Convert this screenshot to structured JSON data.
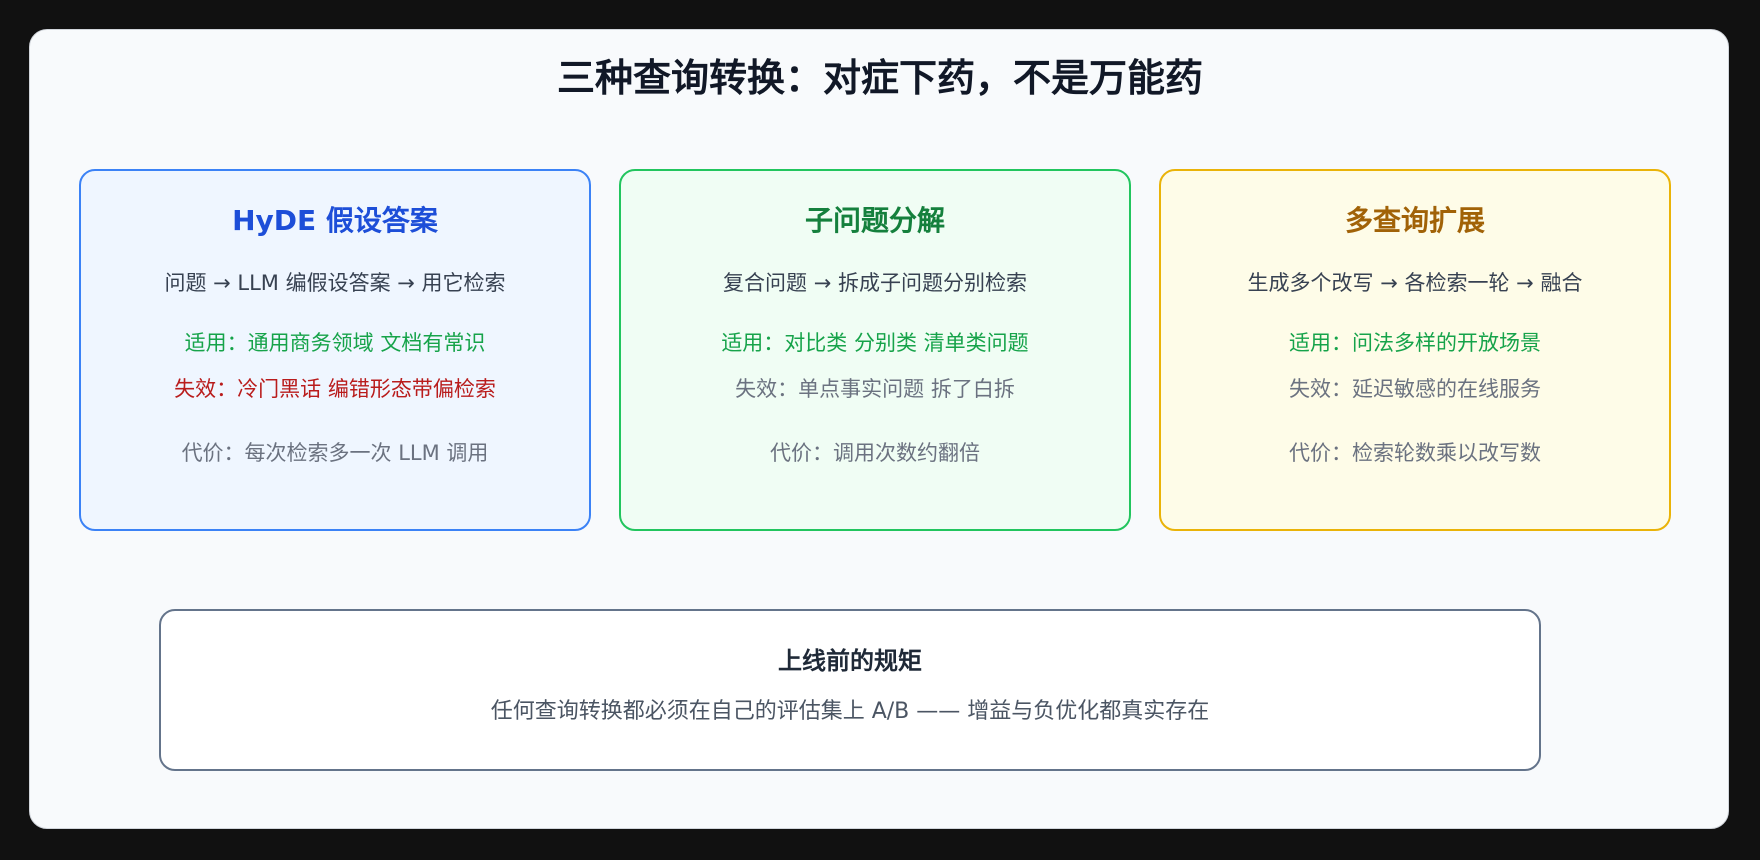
{
  "title": "三种查询转换：对症下药，不是万能药",
  "cards": [
    {
      "title": "HyDE 假设答案",
      "flow": "问题 → LLM 编假设答案 → 用它检索",
      "apply": "适用：通用商务领域 文档有常识",
      "fail": "失效：冷门黑话 编错形态带偏检索",
      "cost": "代价：每次检索多一次 LLM 调用"
    },
    {
      "title": "子问题分解",
      "flow": "复合问题 → 拆成子问题分别检索",
      "apply": "适用：对比类 分别类 清单类问题",
      "fail": "失效：单点事实问题 拆了白拆",
      "cost": "代价：调用次数约翻倍"
    },
    {
      "title": "多查询扩展",
      "flow": "生成多个改写 → 各检索一轮 → 融合",
      "apply": "适用：问法多样的开放场景",
      "fail": "失效：延迟敏感的在线服务",
      "cost": "代价：检索轮数乘以改写数"
    }
  ],
  "rule": {
    "title": "上线前的规矩",
    "text": "任何查询转换都必须在自己的评估集上 A/B —— 增益与负优化都真实存在"
  }
}
